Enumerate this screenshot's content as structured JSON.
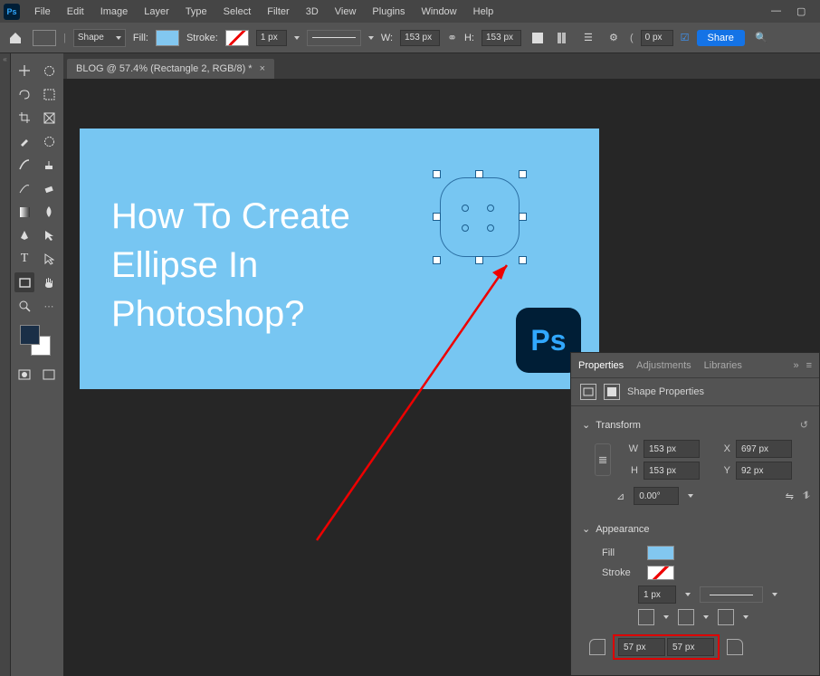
{
  "menu": {
    "items": [
      "File",
      "Edit",
      "Image",
      "Layer",
      "Type",
      "Select",
      "Filter",
      "3D",
      "View",
      "Plugins",
      "Window",
      "Help"
    ]
  },
  "options": {
    "mode": "Shape",
    "fill_label": "Fill:",
    "stroke_label": "Stroke:",
    "stroke_width": "1 px",
    "w_label": "W:",
    "w_value": "153 px",
    "h_label": "H:",
    "h_value": "153 px",
    "radius_value": "0 px",
    "share": "Share"
  },
  "doc": {
    "tab_title": "BLOG @ 57.4% (Rectangle 2, RGB/8) *"
  },
  "canvas": {
    "title_text": "How To Create\nEllipse In\nPhotoshop?",
    "ps_logo": "Ps"
  },
  "panels": {
    "tabs": [
      "Properties",
      "Adjustments",
      "Libraries"
    ],
    "shape_props": "Shape Properties",
    "transform": {
      "title": "Transform",
      "w_label": "W",
      "w_value": "153 px",
      "h_label": "H",
      "h_value": "153 px",
      "x_label": "X",
      "x_value": "697 px",
      "y_label": "Y",
      "y_value": "92 px",
      "rot_value": "0.00°"
    },
    "appearance": {
      "title": "Appearance",
      "fill_label": "Fill",
      "stroke_label": "Stroke",
      "stroke_w": "1 px",
      "corner1": "57 px",
      "corner2": "57 px"
    }
  },
  "colors": {
    "accent": "#1473e6",
    "canvas_fill": "#77c6f2"
  }
}
